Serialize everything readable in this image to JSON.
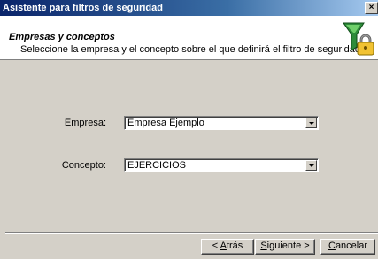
{
  "window": {
    "title": "Asistente para filtros de seguridad",
    "close_glyph": "×"
  },
  "header": {
    "title": "Empresas y conceptos",
    "subtitle": "Seleccione la empresa y el concepto sobre el que definirá el filtro de seguridad",
    "icon": "filter-lock-icon"
  },
  "form": {
    "empresa_label": "Empresa:",
    "empresa_value": "Empresa Ejemplo",
    "concepto_label": "Concepto:",
    "concepto_value": "EJERCICIOS"
  },
  "buttons": {
    "back_prefix": "< ",
    "back_accel": "A",
    "back_rest": "trás",
    "next_accel": "S",
    "next_rest": "iguiente >",
    "cancel_accel": "C",
    "cancel_rest": "ancelar"
  }
}
